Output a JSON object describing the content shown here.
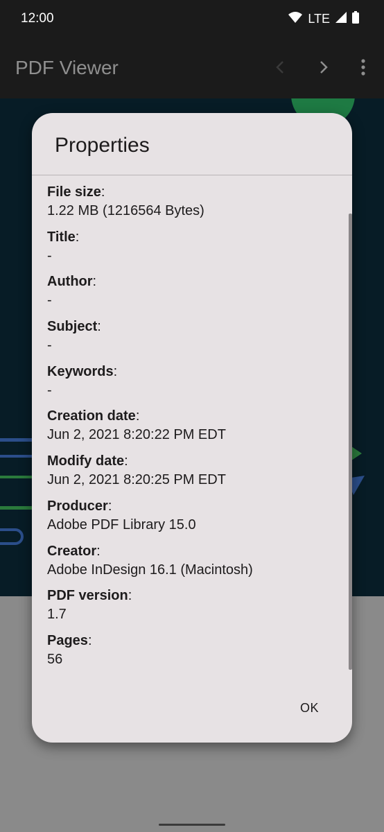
{
  "status_bar": {
    "time": "12:00",
    "network": "LTE"
  },
  "app_bar": {
    "title": "PDF Viewer"
  },
  "dialog": {
    "title": "Properties",
    "ok_label": "OK",
    "properties": [
      {
        "label": "File size",
        "value": "1.22 MB (1216564 Bytes)"
      },
      {
        "label": "Title",
        "value": "-"
      },
      {
        "label": "Author",
        "value": "-"
      },
      {
        "label": "Subject",
        "value": "-"
      },
      {
        "label": "Keywords",
        "value": "-"
      },
      {
        "label": "Creation date",
        "value": "Jun 2, 2021 8:20:22 PM EDT"
      },
      {
        "label": "Modify date",
        "value": "Jun 2, 2021 8:20:25 PM EDT"
      },
      {
        "label": "Producer",
        "value": "Adobe PDF Library 15.0"
      },
      {
        "label": "Creator",
        "value": "Adobe InDesign 16.1 (Macintosh)"
      },
      {
        "label": "PDF version",
        "value": "1.7"
      },
      {
        "label": "Pages",
        "value": "56"
      }
    ]
  }
}
